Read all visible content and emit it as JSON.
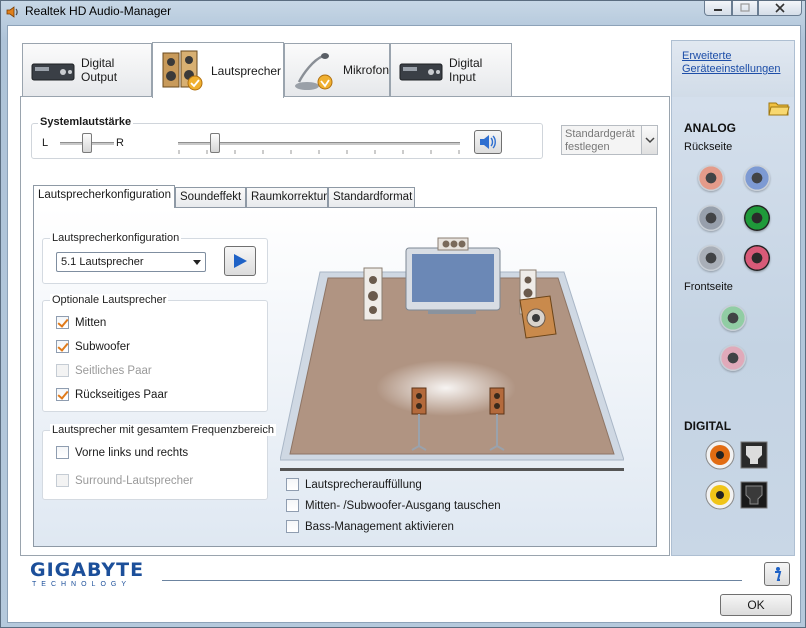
{
  "window": {
    "title": "Realtek HD Audio-Manager"
  },
  "device_tabs": [
    {
      "label": "Digital Output",
      "icon": "digital-output-icon"
    },
    {
      "label": "Lautsprecher",
      "icon": "speakers-icon",
      "active": true
    },
    {
      "label": "Mikrofon",
      "icon": "microphone-icon"
    },
    {
      "label": "Digital Input",
      "icon": "digital-input-icon"
    }
  ],
  "volume": {
    "group_label": "Systemlautstärke",
    "left_label": "L",
    "right_label": "R",
    "balance_value": 0.5,
    "volume_value": 0.13,
    "default_device_label": "Standardgerät festlegen"
  },
  "sub_tabs": [
    {
      "label": "Lautsprecherkonfiguration",
      "active": true
    },
    {
      "label": "Soundeffekt"
    },
    {
      "label": "Raumkorrektur"
    },
    {
      "label": "Standardformat"
    }
  ],
  "speaker_config": {
    "group_label": "Lautsprecherkonfiguration",
    "selected": "5.1 Lautsprecher"
  },
  "optional_speakers": {
    "group_label": "Optionale Lautsprecher",
    "items": [
      {
        "label": "Mitten",
        "checked": true,
        "enabled": true
      },
      {
        "label": "Subwoofer",
        "checked": true,
        "enabled": true
      },
      {
        "label": "Seitliches Paar",
        "checked": false,
        "enabled": false
      },
      {
        "label": "Rückseitiges Paar",
        "checked": true,
        "enabled": true
      }
    ]
  },
  "fullrange": {
    "group_label": "Lautsprecher mit gesamtem Frequenzbereich",
    "items": [
      {
        "label": "Vorne links und rechts",
        "checked": false,
        "enabled": true
      },
      {
        "label": "Surround-Lautsprecher",
        "checked": false,
        "enabled": false
      }
    ]
  },
  "bottom_options": [
    {
      "label": "Lautsprecherauffüllung",
      "checked": false
    },
    {
      "label": "Mitten- /Subwoofer-Ausgang tauschen",
      "checked": false
    },
    {
      "label": "Bass-Management aktivieren",
      "checked": false
    }
  ],
  "sidebar": {
    "advanced_link": "Erweiterte Geräteeinstellungen",
    "analog_label": "ANALOG",
    "rear_label": "Rückseite",
    "front_label": "Frontseite",
    "digital_label": "DIGITAL",
    "rear_jacks": [
      {
        "color": "#e8907a",
        "state": "inactive"
      },
      {
        "color": "#6f8fd0",
        "state": "inactive"
      },
      {
        "color": "#8e96a2",
        "state": "inactive"
      },
      {
        "color": "#1f9a3a",
        "state": "active"
      },
      {
        "color": "#a4a9b0",
        "state": "inactive"
      },
      {
        "color": "#d85a78",
        "state": "active"
      }
    ],
    "front_jacks": [
      {
        "color": "#88cc9a",
        "state": "inactive"
      },
      {
        "color": "#e6a3b4",
        "state": "inactive"
      }
    ]
  },
  "footer": {
    "brand": "GIGABYTE",
    "brand_sub": "TECHNOLOGY",
    "ok_label": "OK"
  }
}
